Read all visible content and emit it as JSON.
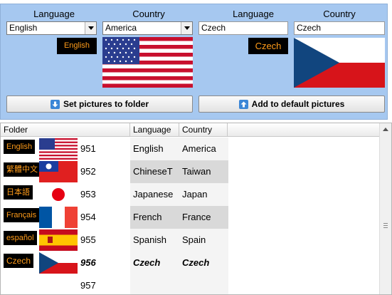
{
  "left": {
    "language_label": "Language",
    "country_label": "Country",
    "language_value": "English",
    "country_value": "America",
    "preview_text": "English",
    "flag": "us-flag"
  },
  "right": {
    "language_label": "Language",
    "country_label": "Country",
    "language_value": "Czech",
    "country_value": "Czech",
    "preview_text": "Czech",
    "flag": "czech-flag"
  },
  "buttons": {
    "set_pictures": "Set pictures to folder",
    "add_default": "Add to default pictures"
  },
  "grid": {
    "columns": [
      "Folder",
      "Language",
      "Country"
    ],
    "rows": [
      {
        "tag": "English",
        "flag": "us-flag",
        "folder": "951",
        "language": "English",
        "country": "America"
      },
      {
        "tag": "繁體中文",
        "flag": "taiwan-flag",
        "folder": "952",
        "language": "ChineseT",
        "country": "Taiwan"
      },
      {
        "tag": "日本語",
        "flag": "japan-flag",
        "folder": "953",
        "language": "Japanese",
        "country": "Japan"
      },
      {
        "tag": "Français",
        "flag": "france-flag",
        "folder": "954",
        "language": "French",
        "country": "France"
      },
      {
        "tag": "español",
        "flag": "spain-flag",
        "folder": "955",
        "language": "Spanish",
        "country": "Spain"
      },
      {
        "tag": "Czech",
        "flag": "czech-flag",
        "folder": "956",
        "language": "Czech",
        "country": "Czech"
      },
      {
        "tag": "",
        "flag": "",
        "folder": "957",
        "language": "",
        "country": ""
      }
    ]
  }
}
